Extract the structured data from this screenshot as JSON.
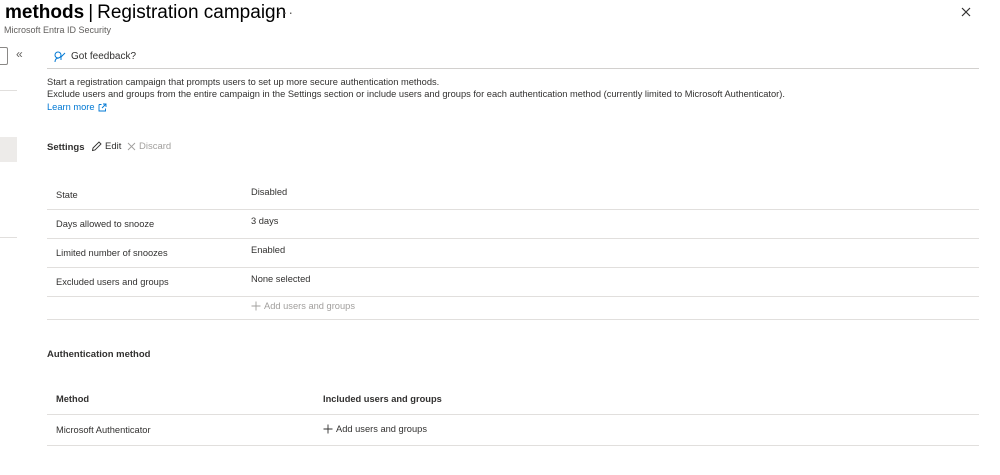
{
  "header": {
    "title_bold": "methods",
    "separator": "|",
    "title_rest": "Registration campaign",
    "more_label": "···",
    "subtitle": "Microsoft Entra ID Security"
  },
  "left_panel": {
    "collapse_label": "«"
  },
  "command_bar": {
    "feedback_label": "Got feedback?"
  },
  "description": {
    "line1": "Start a registration campaign that prompts users to set up more secure authentication methods.",
    "line2": "Exclude users and groups from the entire campaign in the Settings section or include users and groups for each authentication method (currently limited to Microsoft Authenticator).",
    "learn_more": "Learn more"
  },
  "settings": {
    "title": "Settings",
    "edit_label": "Edit",
    "discard_label": "Discard",
    "rows": [
      {
        "label": "State",
        "value": "Disabled"
      },
      {
        "label": "Days allowed to snooze",
        "value": "3 days"
      },
      {
        "label": "Limited number of snoozes",
        "value": "Enabled"
      },
      {
        "label": "Excluded users and groups",
        "value": "None selected"
      }
    ],
    "add_label": "Add users and groups"
  },
  "auth_method": {
    "title": "Authentication method",
    "columns": [
      "Method",
      "Included users and groups"
    ],
    "rows": [
      {
        "method": "Microsoft Authenticator",
        "action": "Add users and groups"
      }
    ]
  }
}
